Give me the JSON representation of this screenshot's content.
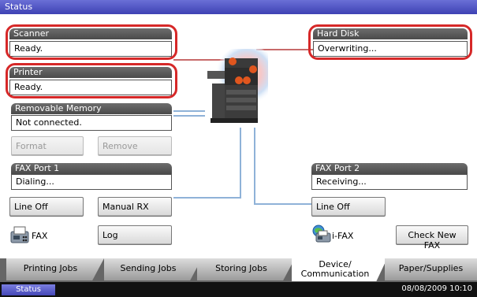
{
  "window": {
    "title": "Status"
  },
  "scanner": {
    "label": "Scanner",
    "value": "Ready."
  },
  "printer": {
    "label": "Printer",
    "value": "Ready."
  },
  "hard_disk": {
    "label": "Hard Disk",
    "value": "Overwriting..."
  },
  "removable_memory": {
    "label": "Removable Memory",
    "value": "Not connected.",
    "format_label": "Format",
    "remove_label": "Remove"
  },
  "fax_port1": {
    "label": "FAX Port 1",
    "value": "Dialing...",
    "line_off_label": "Line Off",
    "manual_rx_label": "Manual RX"
  },
  "fax_port2": {
    "label": "FAX Port 2",
    "value": "Receiving...",
    "line_off_label": "Line Off"
  },
  "fax": {
    "label": "FAX",
    "log_label": "Log",
    "icon": "fax-icon"
  },
  "ifax": {
    "label": "i-FAX",
    "check_label": "Check New FAX",
    "icon": "ifax-icon"
  },
  "tabs": [
    {
      "label": "Printing Jobs"
    },
    {
      "label": "Sending Jobs"
    },
    {
      "label": "Storing Jobs"
    },
    {
      "label": "Device/\nCommunication",
      "line1": "Device/",
      "line2": "Communication",
      "active": true
    },
    {
      "label": "Paper/Supplies"
    }
  ],
  "statusbar": {
    "status_label": "Status",
    "datetime": "08/08/2009  10:10"
  },
  "colors": {
    "title_bar": "#4a4fc4",
    "panel_head": "#5a5a5a",
    "highlight": "#d62828",
    "connector": "#8fb2d8"
  }
}
